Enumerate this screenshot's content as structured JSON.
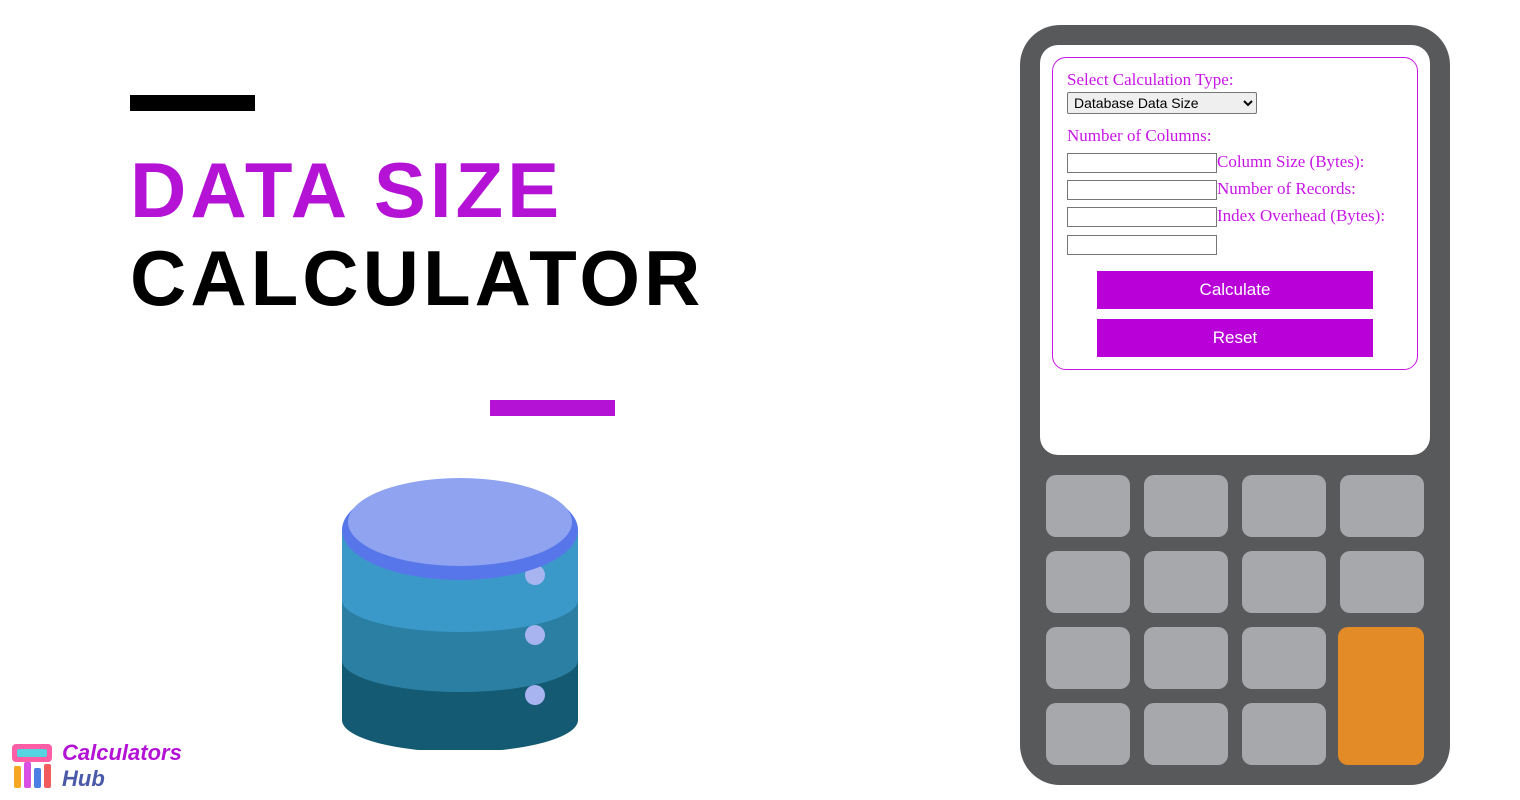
{
  "title": {
    "line1": "DATA SIZE",
    "line2": "CALCULATOR"
  },
  "logo": {
    "name1": "Calculators",
    "name2": "Hub"
  },
  "form": {
    "select_label": "Select Calculation Type:",
    "select_value": "Database Data Size",
    "num_columns_label": "Number of Columns:",
    "column_size_label": "Column Size (Bytes):",
    "num_records_label": "Number of Records:",
    "index_overhead_label": "Index Overhead (Bytes):",
    "calculate_btn": "Calculate",
    "reset_btn": "Reset"
  }
}
